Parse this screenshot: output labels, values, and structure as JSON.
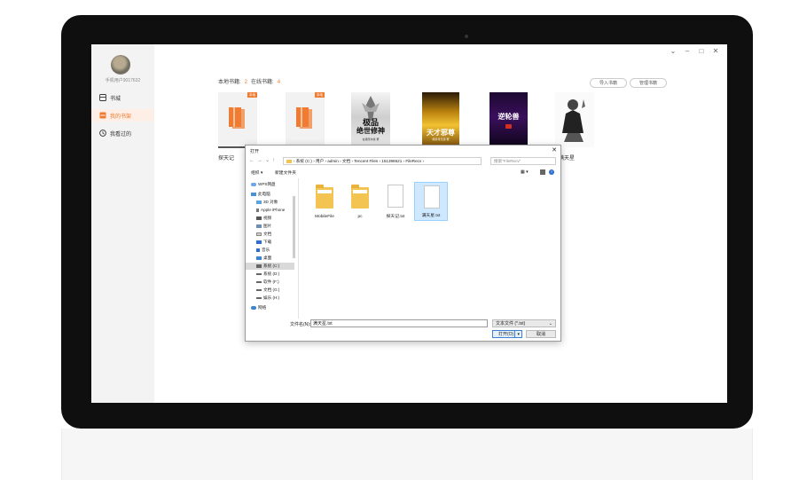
{
  "app": {
    "username": "手机用户9017632",
    "nav": [
      {
        "label": "书城",
        "icon": "store-icon"
      },
      {
        "label": "我的书架",
        "icon": "bookshelf-icon"
      },
      {
        "label": "我看过的",
        "icon": "history-icon"
      }
    ],
    "local_label": "本地书籍:",
    "local_count": "2",
    "online_label": "在线书籍:",
    "online_count": "4",
    "import_label": "导入书籍",
    "manage_label": "管理书籍",
    "local_tag": "本地",
    "book_names": [
      "探天记",
      "满天星"
    ],
    "covers": {
      "c3": {
        "title": "极品",
        "subtitle": "绝世修神",
        "author": "在贤所水旗·著"
      },
      "c4": {
        "title": "天才邪尊",
        "author": "暗赤月天涯·著"
      },
      "c5": {
        "title": "逆轮兽"
      }
    },
    "accent": "#f07b32"
  },
  "dialog": {
    "title": "打开",
    "address": "› 系统 (C:) › 用户 › admin › 文档 › Tencent Files › 151398621 › FileRecv ›",
    "search_placeholder": "搜索\"FileRecv\"",
    "organize": "组织 ▾",
    "new_folder": "新建文件夹",
    "tree": [
      {
        "label": "WPS网盘",
        "icon": "cloud-icon"
      },
      {
        "label": "此电脑",
        "icon": "computer-icon"
      },
      {
        "label": "3D 对象",
        "icon": "3d-objects-icon"
      },
      {
        "label": "Apple iPhone",
        "icon": "phone-icon"
      },
      {
        "label": "视频",
        "icon": "video-icon"
      },
      {
        "label": "图片",
        "icon": "picture-icon"
      },
      {
        "label": "文档",
        "icon": "documents-icon"
      },
      {
        "label": "下载",
        "icon": "download-icon"
      },
      {
        "label": "音乐",
        "icon": "music-icon"
      },
      {
        "label": "桌面",
        "icon": "desktop-icon"
      },
      {
        "label": "系统 (C:)",
        "icon": "drive-icon"
      },
      {
        "label": "系统 (D:)",
        "icon": "drive-icon"
      },
      {
        "label": "软件 (F:)",
        "icon": "drive-icon"
      },
      {
        "label": "文档 (G:)",
        "icon": "drive-icon"
      },
      {
        "label": "娱乐 (H:)",
        "icon": "drive-icon"
      },
      {
        "label": "网络",
        "icon": "network-icon"
      }
    ],
    "files": [
      {
        "label": "MobileFile",
        "icon": "folder-icon"
      },
      {
        "label": "pc",
        "icon": "folder-icon"
      },
      {
        "label": "探天记.txt",
        "icon": "text-file-icon"
      },
      {
        "label": "满天星.txt",
        "icon": "text-file-icon"
      }
    ],
    "filename_label": "文件名(N):",
    "filename_value": "满天星.txt",
    "filetype": "文本文件 (*.txt)",
    "open_label": "打开(O)",
    "cancel_label": "取消"
  }
}
